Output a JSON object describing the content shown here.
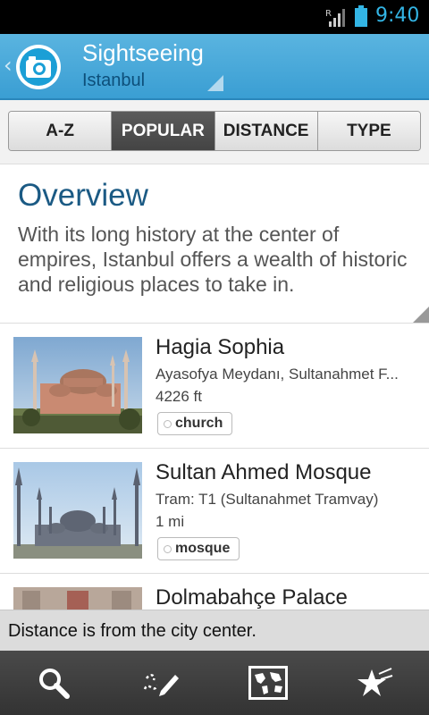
{
  "status_bar": {
    "time": "9:40",
    "roaming_indicator": "R",
    "icons": [
      "signal-icon",
      "battery-icon"
    ],
    "accent_color": "#33b5e5"
  },
  "action_bar": {
    "title": "Sightseeing",
    "subtitle": "Istanbul",
    "icons": [
      "back-chevron-icon",
      "camera-icon",
      "dropdown-indicator-icon"
    ],
    "colors": {
      "background": "#3a9ed3",
      "subtitle": "#0d4f7a"
    }
  },
  "tabs": [
    {
      "label": "A-Z",
      "active": false
    },
    {
      "label": "POPULAR",
      "active": true
    },
    {
      "label": "DISTANCE",
      "active": false
    },
    {
      "label": "TYPE",
      "active": false
    }
  ],
  "overview": {
    "heading": "Overview",
    "text": "With its long history at the center of empires, Istanbul offers a wealth of historic and religious places to take in."
  },
  "places": [
    {
      "name": "Hagia Sophia",
      "address": "Ayasofya Meydanı, Sultanahmet F...",
      "distance": "4226 ft",
      "tag": "church"
    },
    {
      "name": "Sultan Ahmed Mosque",
      "address": "Tram: T1 (Sultanahmet Tramvay)",
      "distance": "1 mi",
      "tag": "mosque"
    },
    {
      "name": "Dolmabahçe Palace",
      "address": "",
      "distance": "",
      "tag": ""
    }
  ],
  "footer_note": "Distance is from the city center.",
  "bottom_bar": {
    "icons": [
      "search-icon",
      "write-note-icon",
      "map-icon",
      "favorites-star-icon"
    ],
    "active_icon": "map-icon"
  }
}
